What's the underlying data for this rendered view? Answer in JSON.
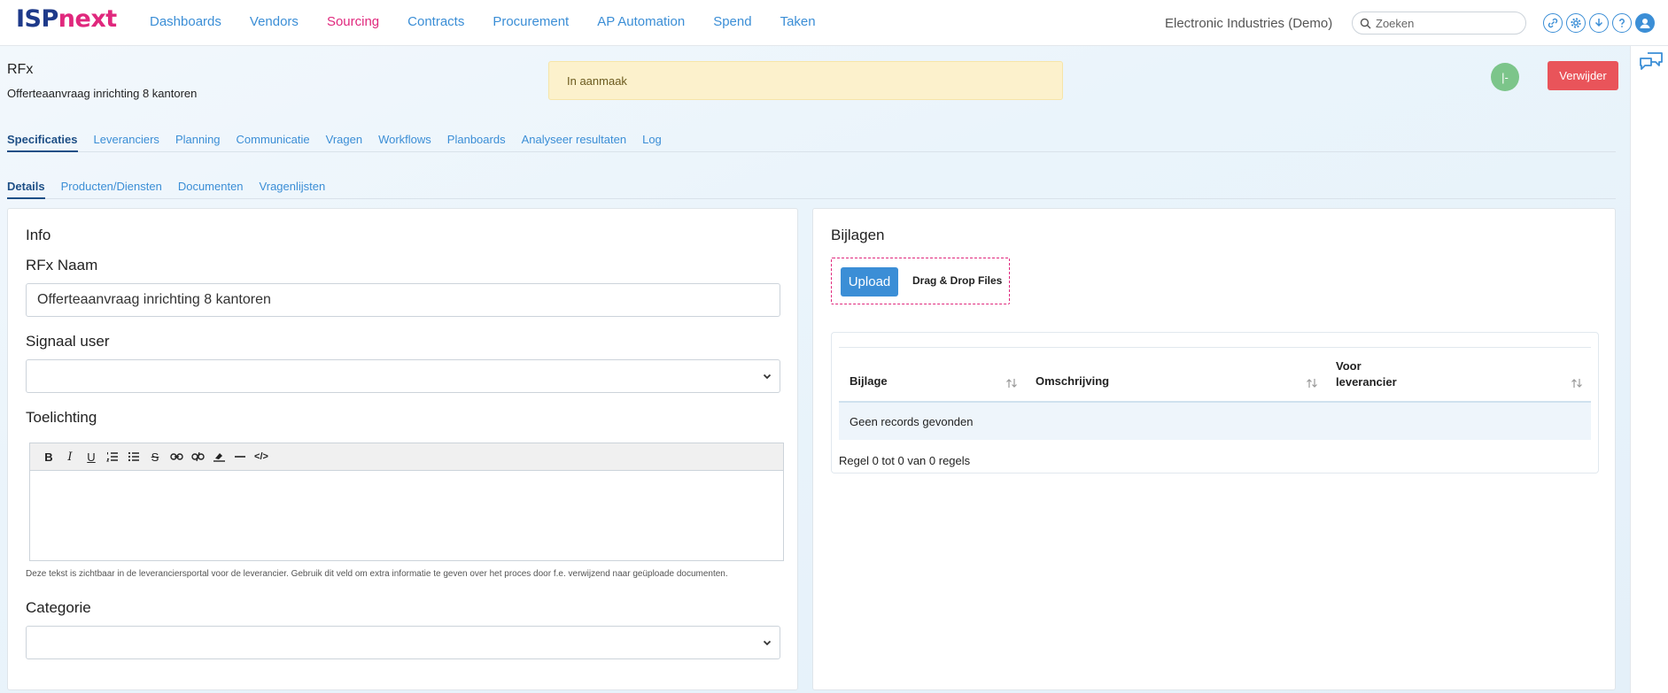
{
  "brand": {
    "part1": "ISP",
    "part2": "next"
  },
  "nav": {
    "items": [
      "Dashboards",
      "Vendors",
      "Sourcing",
      "Contracts",
      "Procurement",
      "AP Automation",
      "Spend",
      "Taken"
    ],
    "active": "Sourcing"
  },
  "company": "Electronic Industries (Demo)",
  "search": {
    "placeholder": "Zoeken",
    "value": ""
  },
  "header": {
    "title": "RFx",
    "subtitle": "Offerteaanvraag inrichting 8 kantoren",
    "status": "In aanmaak",
    "circle_label": "|-",
    "delete_label": "Verwijder"
  },
  "tabs": {
    "items": [
      "Specificaties",
      "Leveranciers",
      "Planning",
      "Communicatie",
      "Vragen",
      "Workflows",
      "Planboards",
      "Analyseer resultaten",
      "Log"
    ],
    "active": "Specificaties"
  },
  "subtabs": {
    "items": [
      "Details",
      "Producten/Diensten",
      "Documenten",
      "Vragenlijsten"
    ],
    "active": "Details"
  },
  "info": {
    "title": "Info",
    "name_label": "RFx Naam",
    "name_value": "Offerteaanvraag inrichting 8 kantoren",
    "signal_label": "Signaal user",
    "signal_value": "",
    "notes_label": "Toelichting",
    "notes_value": "",
    "hint": "Deze tekst is zichtbaar in de leveranciersportal voor de leverancier. Gebruik dit veld om extra informatie te geven over het proces door f.e. verwijzend naar geüploade documenten.",
    "category_label": "Categorie",
    "category_value": ""
  },
  "attachments": {
    "title": "Bijlagen",
    "upload_label": "Upload",
    "dragdrop_label": "Drag & Drop Files",
    "columns": [
      "Bijlage",
      "Omschrijving",
      "Voor leverancier"
    ],
    "column3_lines": [
      "Voor",
      "leverancier"
    ],
    "empty_text": "Geen records gevonden",
    "footer": "Regel 0 tot 0 van 0 regels"
  },
  "colors": {
    "brand_dark": "#1e3a8a",
    "brand_pink": "#e0287d",
    "link_blue": "#3b8ed6",
    "danger": "#e9545a",
    "status_bg": "#fcf1cc",
    "success": "#7cc58a"
  },
  "icons": {
    "search": "search-icon",
    "link": "link-icon",
    "gear": "gear-icon",
    "download": "download-icon",
    "help": "help-icon",
    "user": "user-icon",
    "chat": "chat-icon"
  }
}
